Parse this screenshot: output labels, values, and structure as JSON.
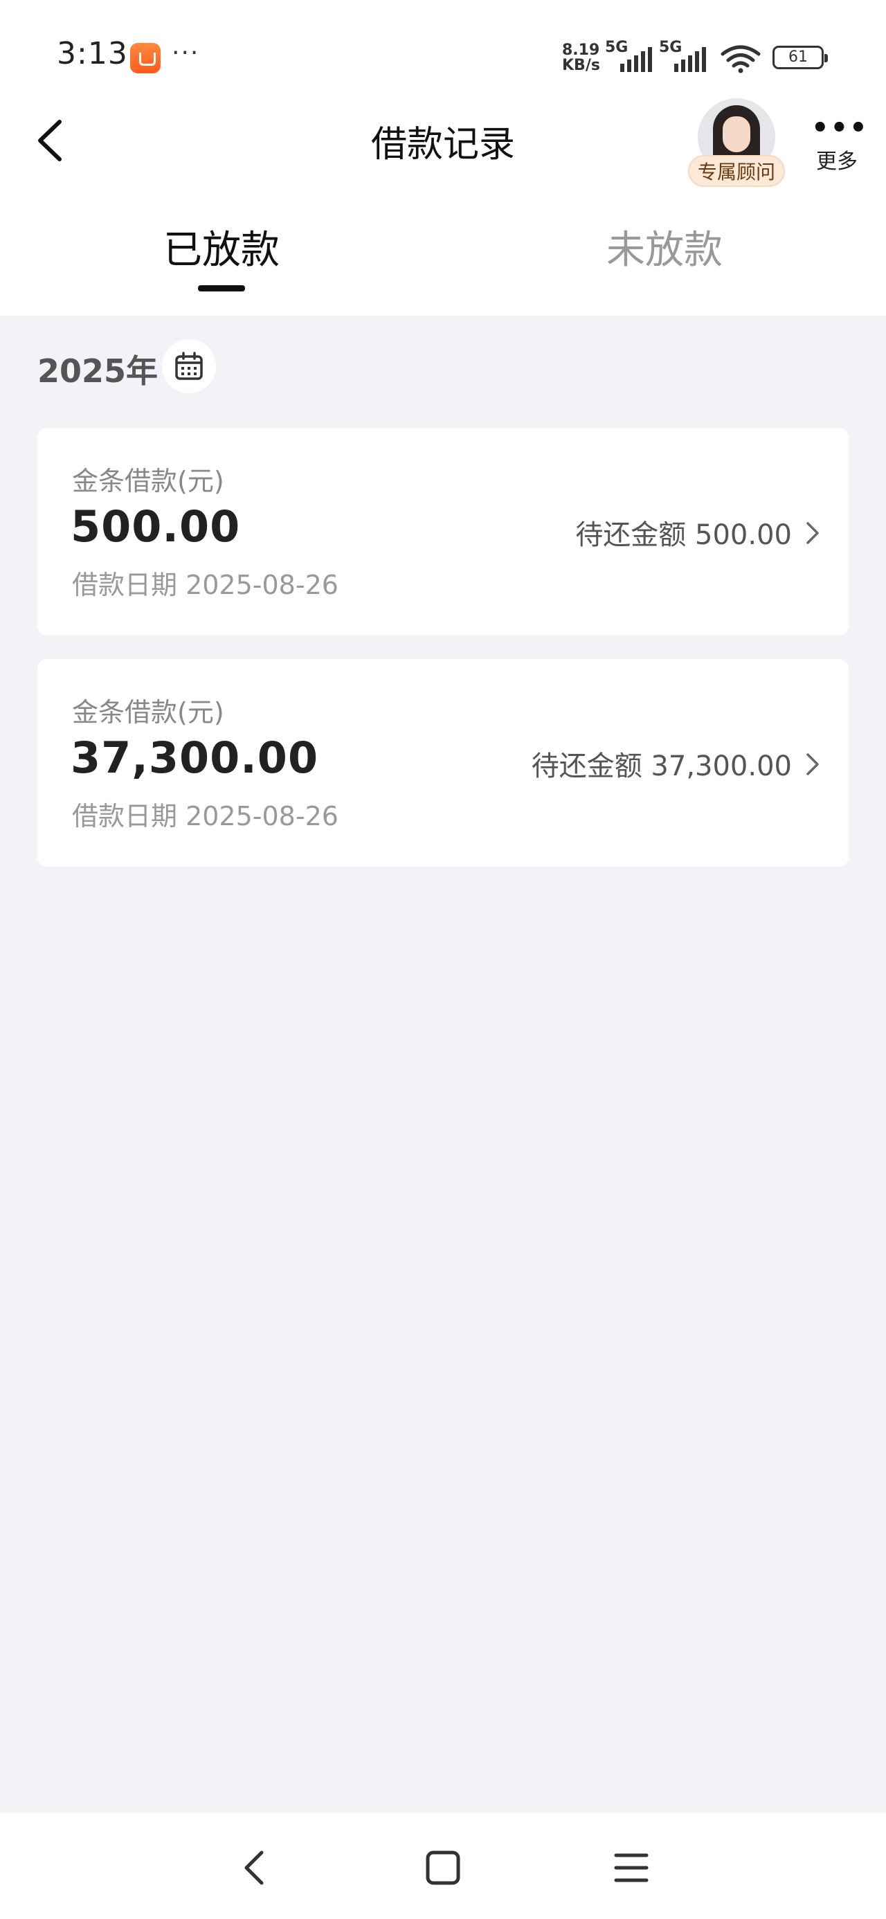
{
  "status_bar": {
    "time": "3:13",
    "overflow": "···",
    "net_speed_value": "8.19",
    "net_speed_unit": "KB/s",
    "sim1": "5G",
    "sim2": "5G",
    "battery": "61"
  },
  "header": {
    "title": "借款记录",
    "advisor_label": "专属顾问",
    "more_label": "更多"
  },
  "tabs": [
    {
      "label": "已放款",
      "active": true
    },
    {
      "label": "未放款",
      "active": false
    }
  ],
  "year_label": "2025年",
  "records": [
    {
      "type_label": "金条借款(元)",
      "amount": "500.00",
      "date_label": "借款日期 2025-08-26",
      "due_label": "待还金额 500.00"
    },
    {
      "type_label": "金条借款(元)",
      "amount": "37,300.00",
      "date_label": "借款日期 2025-08-26",
      "due_label": "待还金额 37,300.00"
    }
  ],
  "colors": {
    "page_background": "#f2f2f7",
    "advisor_badge": "#fde9d8",
    "app_icon": "#ff6a2a"
  }
}
